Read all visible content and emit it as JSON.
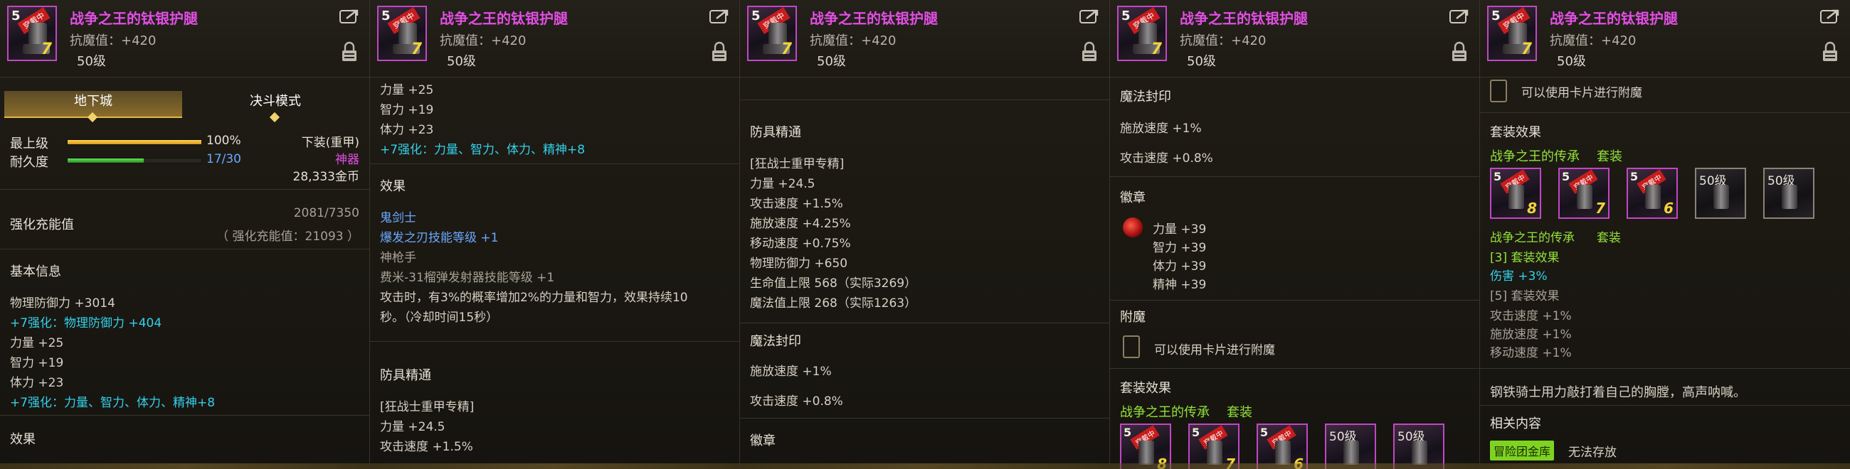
{
  "item": {
    "name": "战争之王的钛银护腿",
    "stat_line": "抗魔值：+420",
    "level": "50级",
    "icon_grade": "5",
    "icon_tag": "穿戴中",
    "icon_level": "7"
  },
  "p1": {
    "tabs": [
      "地下城",
      "决斗模式"
    ],
    "max_label": "最上级",
    "max_value": "100%",
    "max_fill": 1.0,
    "dur_label": "耐久度",
    "dur_value": "17/30",
    "dur_fill": 0.567,
    "slot": "下装(重甲)",
    "rarity": "神器",
    "price": "28,333金币",
    "enhance_label": "强化充能值",
    "enhance_value": "2081/7350",
    "enhance_note": "（ 强化充能值：21093 ）",
    "basic_title": "基本信息",
    "lines": [
      "物理防御力 +3014",
      "+7强化：物理防御力 +404",
      "力量 +25",
      "智力 +19",
      "体力 +23",
      "+7强化：力量、智力、体力、精神+8"
    ],
    "effect_title": "效果"
  },
  "p2": {
    "lines": [
      "力量 +25",
      "智力 +19",
      "体力 +23",
      "+7强化：力量、智力、体力、精神+8"
    ],
    "effect_title": "效果",
    "effect_lines": [
      "鬼剑士",
      "爆发之刃技能等级 +1",
      "神枪手",
      "费米-31榴弹发射器技能等级 +1",
      "攻击时，有3%的概率增加2%的力量和智力，效果持续10",
      "秒。（冷却时间15秒）"
    ],
    "mastery_title": "防具精通",
    "mastery_lines": [
      "[狂战士重甲专精]",
      "力量 +24.5",
      "攻击速度 +1.5%"
    ]
  },
  "p3": {
    "mastery_title": "防具精通",
    "mastery_lines": [
      "[狂战士重甲专精]",
      "力量 +24.5",
      "攻击速度 +1.5%",
      "施放速度 +4.25%",
      "移动速度 +0.75%",
      "物理防御力 +650",
      "生命值上限 568（实际3269）",
      "魔法值上限 268（实际1263）"
    ],
    "seal_title": "魔法封印",
    "seal_lines": [
      "施放速度 +1%",
      "攻击速度 +0.8%"
    ],
    "emblem_title": "徽章"
  },
  "p4": {
    "seal_title": "魔法封印",
    "seal_lines": [
      "施放速度 +1%",
      "攻击速度 +0.8%"
    ],
    "emblem_title": "徽章",
    "emblem_lines": [
      "力量 +39",
      "智力 +39",
      "体力 +39",
      "精神 +39"
    ],
    "enchant_title": "附魔",
    "enchant_text": "可以使用卡片进行附魔",
    "set_title": "套装效果",
    "set_name": "战争之王的传承",
    "set_label": "套装",
    "set_icons": [
      {
        "grade": "5",
        "tag": "穿戴中",
        "level": "8"
      },
      {
        "grade": "5",
        "tag": "穿戴中",
        "level": "7"
      },
      {
        "grade": "5",
        "tag": "穿戴中",
        "level": "6"
      },
      {
        "level_text": "50级"
      },
      {
        "level_text": "50级"
      }
    ]
  },
  "p5": {
    "enchant_text": "可以使用卡片进行附魔",
    "set_title": "套装效果",
    "set_name": "战争之王的传承",
    "set_label": "套装",
    "set_icons": [
      {
        "grade": "5",
        "tag": "穿戴中",
        "level": "8"
      },
      {
        "grade": "5",
        "tag": "穿戴中",
        "level": "7"
      },
      {
        "grade": "5",
        "tag": "穿戴中",
        "level": "6"
      },
      {
        "level_text": "50级"
      },
      {
        "level_text": "50级"
      }
    ],
    "set_bonus3": "[3] 套装效果",
    "set_bonus3_line": "伤害 +3%",
    "set_bonus5": "[5] 套装效果",
    "set_bonus5_lines": [
      "攻击速度 +1%",
      "施放速度 +1%",
      "移动速度 +1%"
    ],
    "flavor": "钢铁骑士用力敲打着自己的胸膛，高声呐喊。",
    "related_title": "相关内容",
    "related_badge": "冒险团金库",
    "related_text": "无法存放"
  }
}
